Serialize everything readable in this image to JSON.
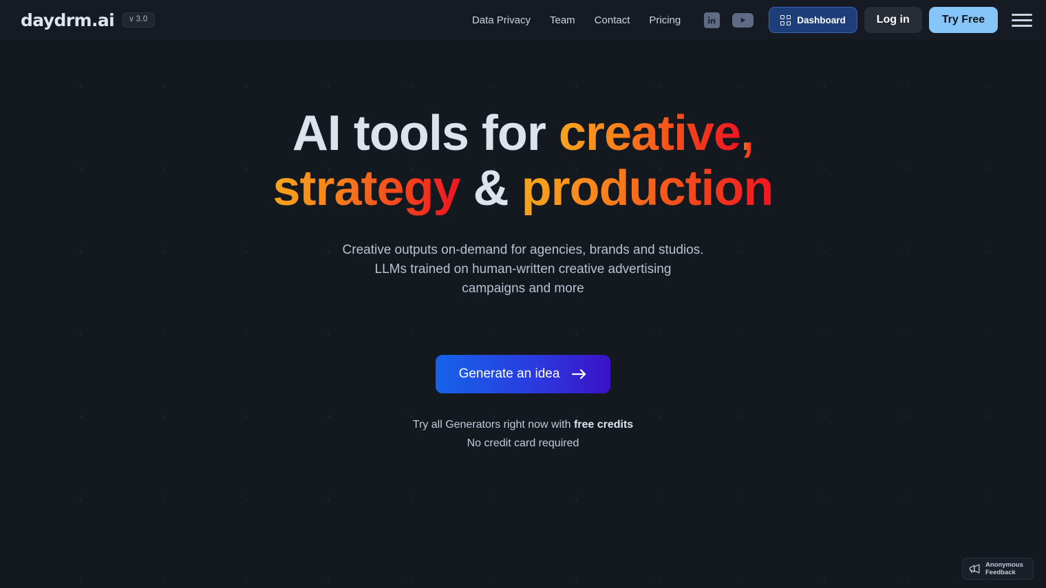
{
  "header": {
    "brand": "daydrm.ai",
    "version_badge": "v 3.0",
    "nav_links": [
      {
        "label": "Data Privacy",
        "name": "nav-link-data-privacy"
      },
      {
        "label": "Team",
        "name": "nav-link-team"
      },
      {
        "label": "Contact",
        "name": "nav-link-contact"
      },
      {
        "label": "Pricing",
        "name": "nav-link-pricing"
      }
    ],
    "social": [
      {
        "name": "linkedin-icon",
        "label": "in"
      },
      {
        "name": "youtube-icon",
        "label": ""
      }
    ],
    "dashboard_button": "Dashboard",
    "dashboard_icon": "grid-icon",
    "login_button": "Log in",
    "try_free_button": "Try Free",
    "menu_icon": "hamburger-menu-icon"
  },
  "hero": {
    "headline": {
      "line1_plain": "AI tools for ",
      "line1_grad": "creative",
      "line1_comma": ",",
      "line2_grad_a": "strategy",
      "line2_amp": " & ",
      "line2_grad_b": "production"
    },
    "subtitle_line1": "Creative outputs on-demand for agencies, brands and studios.",
    "subtitle_line2": "LLMs trained on human-written creative advertising",
    "subtitle_line3": "campaigns and more",
    "cta_label": "Generate an idea",
    "cta_arrow_icon": "arrow-right-icon",
    "cta_sub_prefix": "Try all Generators right now with ",
    "cta_sub_bold": "free credits",
    "cta_sub_line2": "No credit card required"
  },
  "feedback_widget": {
    "line1": "Anonymous",
    "line2": "Feedback",
    "icon": "megaphone-icon"
  },
  "colors": {
    "page_bg": "#141920",
    "header_bg": "#161b23",
    "gradient_start": "#f6a81e",
    "gradient_end": "#ef1122",
    "cta_gradient_start": "#1663e8",
    "cta_gradient_end": "#3a12c8",
    "try_free_bg": "#86c5f7",
    "dashboard_bg": "#1e3e7a"
  }
}
